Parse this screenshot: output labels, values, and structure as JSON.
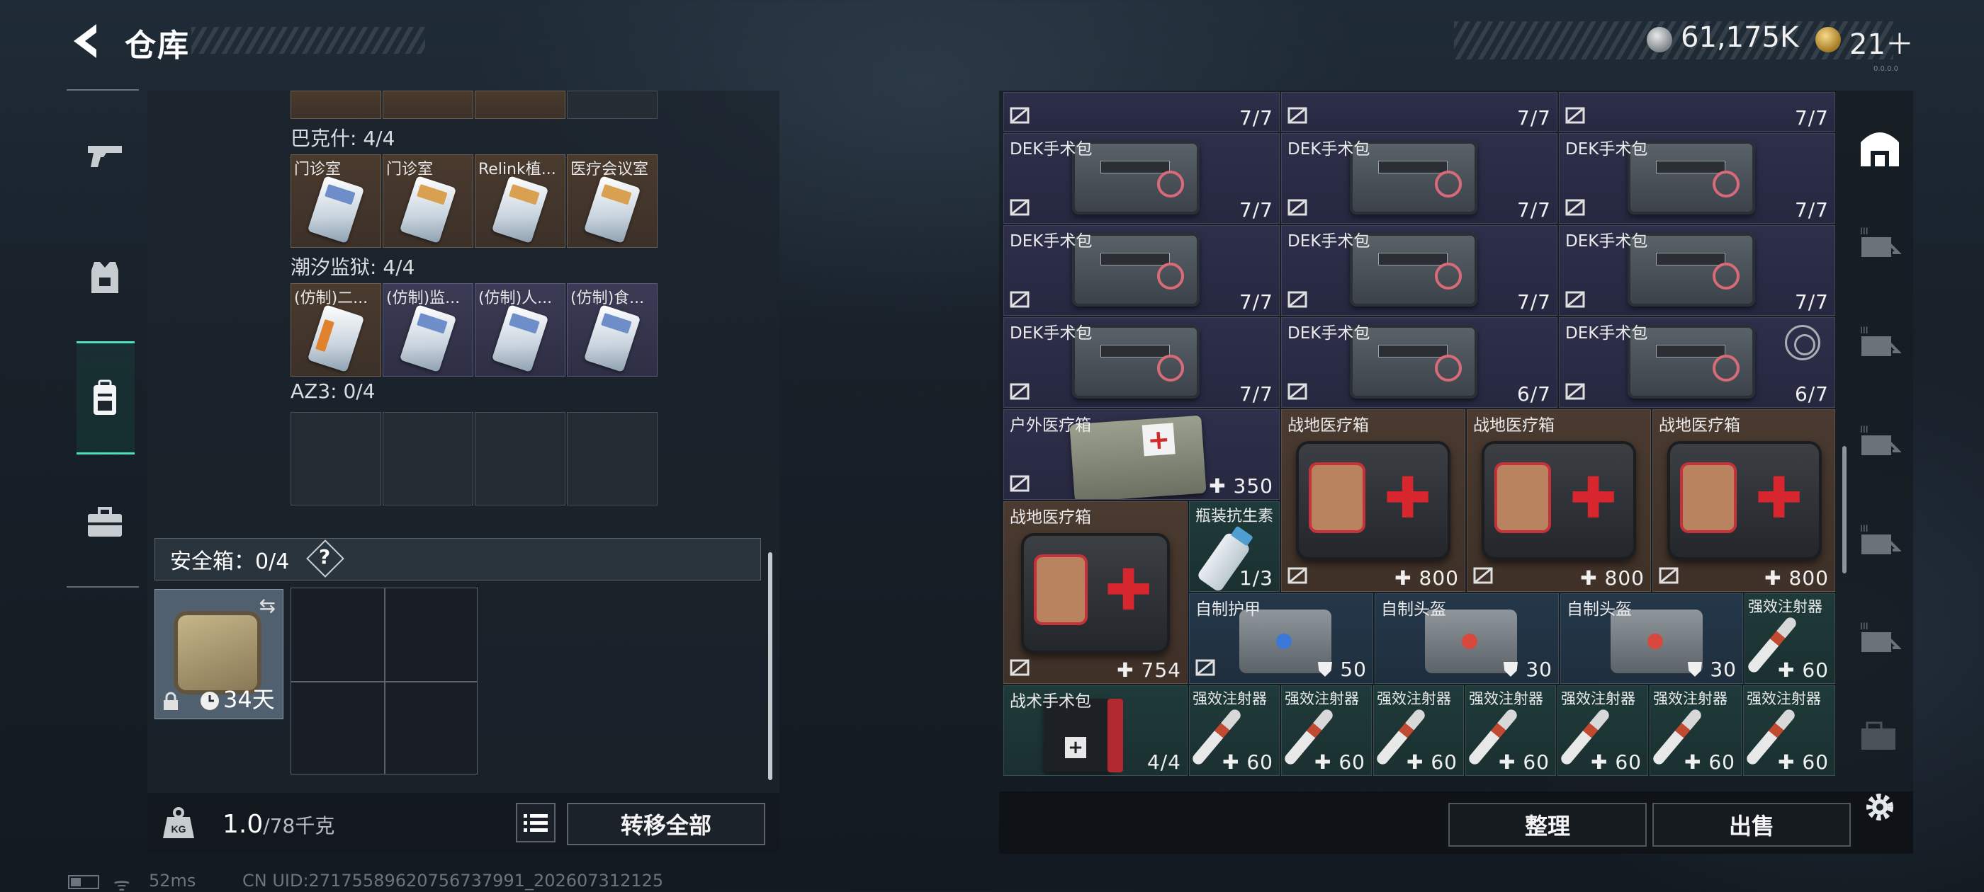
{
  "header": {
    "title": "仓库",
    "currency_silver": "61,175K",
    "currency_gold": "21＋",
    "version": "0.0.0.0"
  },
  "nav": {
    "icons": [
      "pistol-icon",
      "armor-vest-icon",
      "backpack-icon",
      "briefcase-icon"
    ],
    "active_index": 2
  },
  "containers": [
    {
      "label": "巴克什: 4/4",
      "items": [
        {
          "name": "门诊室",
          "style": "brown",
          "card": "blue"
        },
        {
          "name": "门诊室",
          "style": "brown",
          "card": "gold"
        },
        {
          "name": "Relink植...",
          "style": "brown",
          "card": "gold"
        },
        {
          "name": "医疗会议室",
          "style": "brown",
          "card": "gold"
        }
      ]
    },
    {
      "label": "潮汐监狱: 4/4",
      "items": [
        {
          "name": "(仿制)二...",
          "style": "brown",
          "card": "orange"
        },
        {
          "name": "(仿制)监...",
          "style": "purple",
          "card": "blue"
        },
        {
          "name": "(仿制)人...",
          "style": "purple",
          "card": "blue"
        },
        {
          "name": "(仿制)食...",
          "style": "purple",
          "card": "blue"
        }
      ]
    },
    {
      "label": "AZ3: 0/4",
      "items": []
    }
  ],
  "safe": {
    "label": "安全箱：0/4",
    "help": "?",
    "timer": "34天"
  },
  "weight": {
    "current": "1.0",
    "max": "/78千克"
  },
  "buttons": {
    "transfer_all": "转移全部",
    "sort": "整理",
    "sell": "出售"
  },
  "status": {
    "ping": "52ms",
    "uid": "CN UID:27175589620756737991_202607312125"
  },
  "stash": {
    "top_partial": [
      "7/7",
      "7/7",
      "7/7"
    ],
    "surgical_rows": [
      [
        {
          "name": "DEK手术包",
          "qty": "7/7"
        },
        {
          "name": "DEK手术包",
          "qty": "7/7"
        },
        {
          "name": "DEK手术包",
          "qty": "7/7"
        }
      ],
      [
        {
          "name": "DEK手术包",
          "qty": "7/7"
        },
        {
          "name": "DEK手术包",
          "qty": "7/7"
        },
        {
          "name": "DEK手术包",
          "qty": "7/7"
        }
      ],
      [
        {
          "name": "DEK手术包",
          "qty": "7/7"
        },
        {
          "name": "DEK手术包",
          "qty": "6/7"
        },
        {
          "name": "DEK手术包",
          "qty": "6/7"
        }
      ]
    ],
    "outdoor_kit": {
      "name": "户外医疗箱",
      "qty": "350"
    },
    "field_kits": [
      {
        "name": "战地医疗箱",
        "qty": "800"
      },
      {
        "name": "战地医疗箱",
        "qty": "800"
      },
      {
        "name": "战地医疗箱",
        "qty": "800"
      }
    ],
    "field_kit_large": {
      "name": "战地医疗箱",
      "qty": "754"
    },
    "antibiotic": {
      "name": "瓶装抗生素",
      "qty": "1/3"
    },
    "armor": {
      "name": "自制护甲",
      "qty": "50"
    },
    "helmets": [
      {
        "name": "自制头盔",
        "qty": "30"
      },
      {
        "name": "自制头盔",
        "qty": "30"
      }
    ],
    "injector_top": {
      "name": "强效注射器",
      "qty": "60"
    },
    "tactical_kit": {
      "name": "战术手术包",
      "qty": "4/4"
    },
    "injectors": [
      {
        "name": "强效注射器",
        "qty": "60"
      },
      {
        "name": "强效注射器",
        "qty": "60"
      },
      {
        "name": "强效注射器",
        "qty": "60"
      },
      {
        "name": "强效注射器",
        "qty": "60"
      },
      {
        "name": "强效注射器",
        "qty": "60"
      },
      {
        "name": "强效注射器",
        "qty": "60"
      },
      {
        "name": "强效注射器",
        "qty": "60"
      }
    ]
  },
  "colors": {
    "accent": "#4ee0b8",
    "navy_cell": "#2e2f4a",
    "brown_cell": "#4a3a30",
    "teal_cell": "#1f3a3a",
    "steel_cell": "#24384a"
  }
}
